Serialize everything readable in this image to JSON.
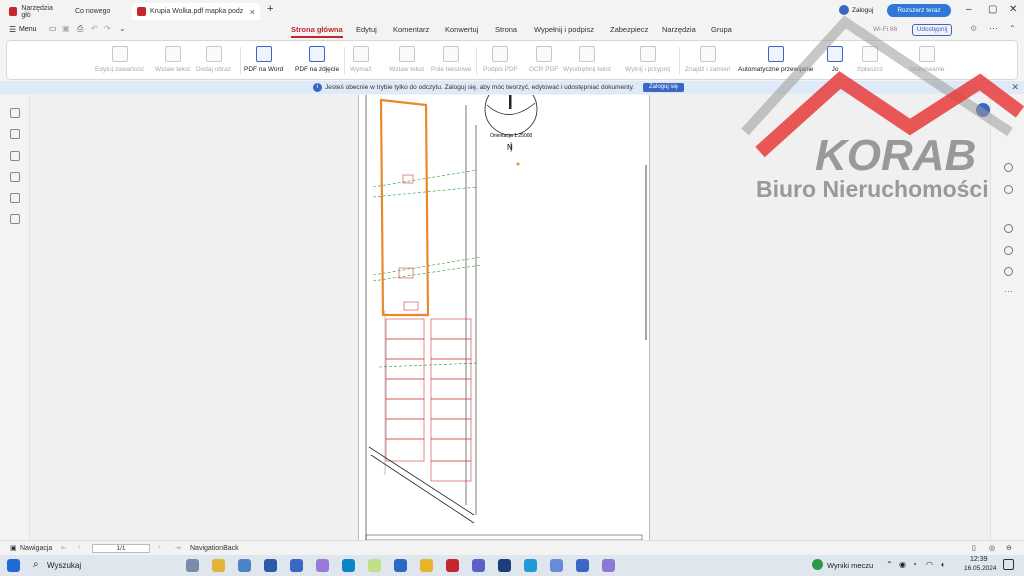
{
  "tabs": [
    {
      "label": "Narzędzia głó"
    },
    {
      "label": "Co nowego"
    },
    {
      "label": "Krupia Wolka.pdf mapka podz"
    }
  ],
  "menu_label": "Menu",
  "ribbon_tabs": [
    "Strona główna",
    "Edytuj",
    "Komentarz",
    "Konwertuj",
    "Strona",
    "Wypełnij i podpisz",
    "Zabezpiecz",
    "Narzędzia",
    "Grupa"
  ],
  "account": {
    "login": "Zaloguj",
    "upgrade": "Rozszerz teraz",
    "share": "Udostępnij",
    "wifi": "Wi-Fi 86"
  },
  "ribbon_buttons": [
    "Edytuj zawartość",
    "Wstaw tekst",
    "Dodaj obraz",
    "PDF na Word",
    "PDF na zdjęcie",
    "Wymaż",
    "Wstaw tekst",
    "Pole tekstowe",
    "Podpis PDF",
    "OCR PDF",
    "Wyodrębnij tekst",
    "Wytnij i przypnij",
    "Znajdź i zamień",
    "Automatyczne przewijanie",
    "Jo",
    "Spłaszcz",
    "Skanowanie"
  ],
  "infobar": {
    "message": "Jesteś obecnie w trybie tylko do odczytu. Zaloguj się, aby móc tworzyć, edytować i udostępniać dokumenty.",
    "button": "Zaloguj się"
  },
  "map": {
    "orientation": "Orientacja  1:25000",
    "north": "N"
  },
  "statusbar": {
    "nav": "Nawigacja",
    "page": "1/1",
    "nav_back": "NavigationBack"
  },
  "taskbar": {
    "search": "Wyszukaj",
    "weather": "Wyniki meczu",
    "time": "12:39",
    "date": "16.05.2024"
  },
  "watermark": {
    "brand": "KORAB",
    "subtitle": "Biuro Nieruchomości"
  },
  "colors": {
    "accent": "#c4262e",
    "link": "#3a66c4",
    "plot_border": "#e8892c",
    "watermark_red": "#e83b3b"
  }
}
